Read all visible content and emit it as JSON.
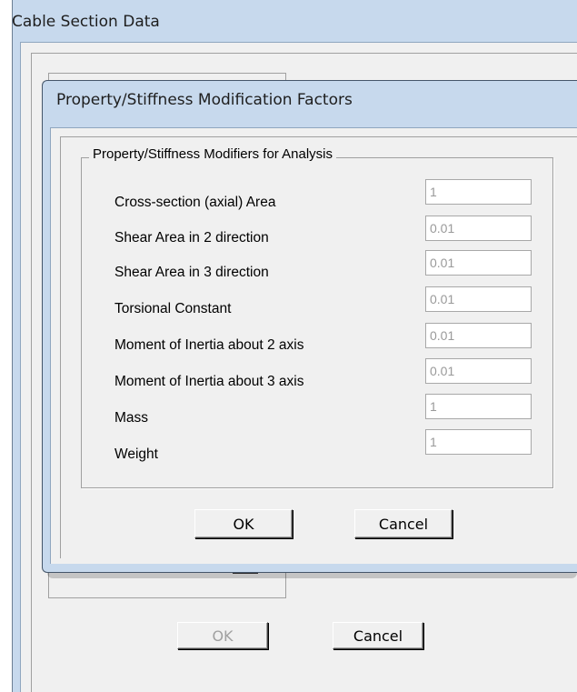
{
  "background_window": {
    "title": "Cable Section Data",
    "ok_label": "OK",
    "cancel_label": "Cancel"
  },
  "dialog": {
    "title": "Property/Stiffness Modification Factors",
    "group_label": "Property/Stiffness Modifiers for Analysis",
    "rows": [
      {
        "label": "Cross-section (axial) Area",
        "value": "1"
      },
      {
        "label": "Shear Area in 2 direction",
        "value": "0.01"
      },
      {
        "label": "Shear Area in 3 direction",
        "value": "0.01"
      },
      {
        "label": "Torsional Constant",
        "value": "0.01"
      },
      {
        "label": "Moment of Inertia about 2 axis",
        "value": "0.01"
      },
      {
        "label": "Moment of Inertia about 3 axis",
        "value": "0.01"
      },
      {
        "label": "Mass",
        "value": "1"
      },
      {
        "label": "Weight",
        "value": "1"
      }
    ],
    "ok_label": "OK",
    "cancel_label": "Cancel"
  },
  "colors": {
    "title_bar": "#c7d9ed",
    "dialog_face": "#f0f0f0",
    "disabled_text": "#a0a0a0"
  }
}
